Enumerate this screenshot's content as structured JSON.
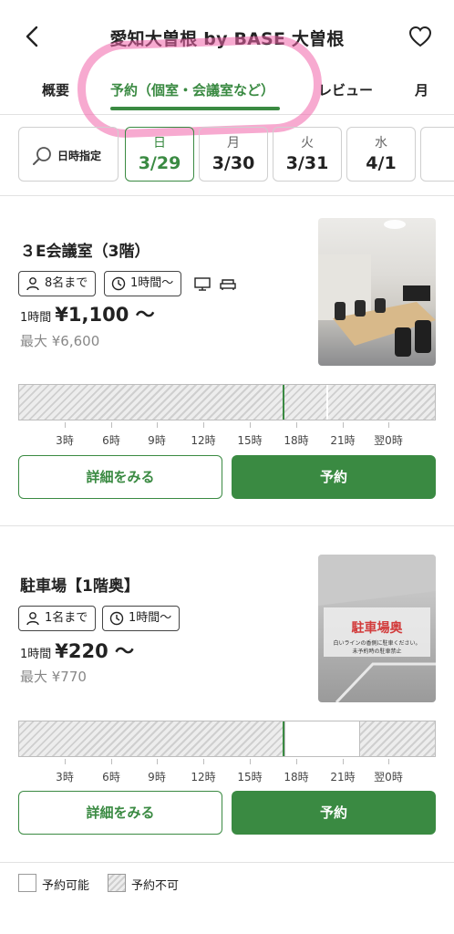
{
  "header": {
    "title": "愛知大曽根 by BASE 大曽根"
  },
  "tabs": [
    {
      "label": "概要"
    },
    {
      "label": "予約（個室・会議室など）"
    },
    {
      "label": "レビュー"
    },
    {
      "label": "月"
    }
  ],
  "date_bar": {
    "search_label": "日時指定",
    "days": [
      {
        "dow": "日",
        "date": "3/29",
        "selected": true
      },
      {
        "dow": "月",
        "date": "3/30"
      },
      {
        "dow": "火",
        "date": "3/31"
      },
      {
        "dow": "水",
        "date": "4/1"
      }
    ]
  },
  "timeline": {
    "labels": [
      "3時",
      "6時",
      "9時",
      "12時",
      "15時",
      "18時",
      "21時",
      "翌0時"
    ]
  },
  "spaces": [
    {
      "name": "３E会議室（3階）",
      "capacity": "8名まで",
      "min_time": "1時間〜",
      "amenities": [
        "monitor-icon",
        "sofa-icon"
      ],
      "price_unit": "1時間",
      "price": "¥1,100 〜",
      "max_price": "最大 ¥6,600",
      "details_label": "詳細をみる",
      "reserve_label": "予約"
    },
    {
      "name": "駐車場【1階奥】",
      "capacity": "1名まで",
      "min_time": "1時間〜",
      "price_unit": "1時間",
      "price": "¥220 〜",
      "max_price": "最大 ¥770",
      "photo_label": "駐車場奥",
      "photo_sub1": "白いラインの香側に駐車ください。",
      "photo_sub2": "未予約時の駐車禁止",
      "details_label": "詳細をみる",
      "reserve_label": "予約"
    }
  ],
  "legend": {
    "available": "予約可能",
    "unavailable": "予約不可"
  },
  "colors": {
    "accent": "#3a8a42",
    "highlight": "#f064aa"
  }
}
